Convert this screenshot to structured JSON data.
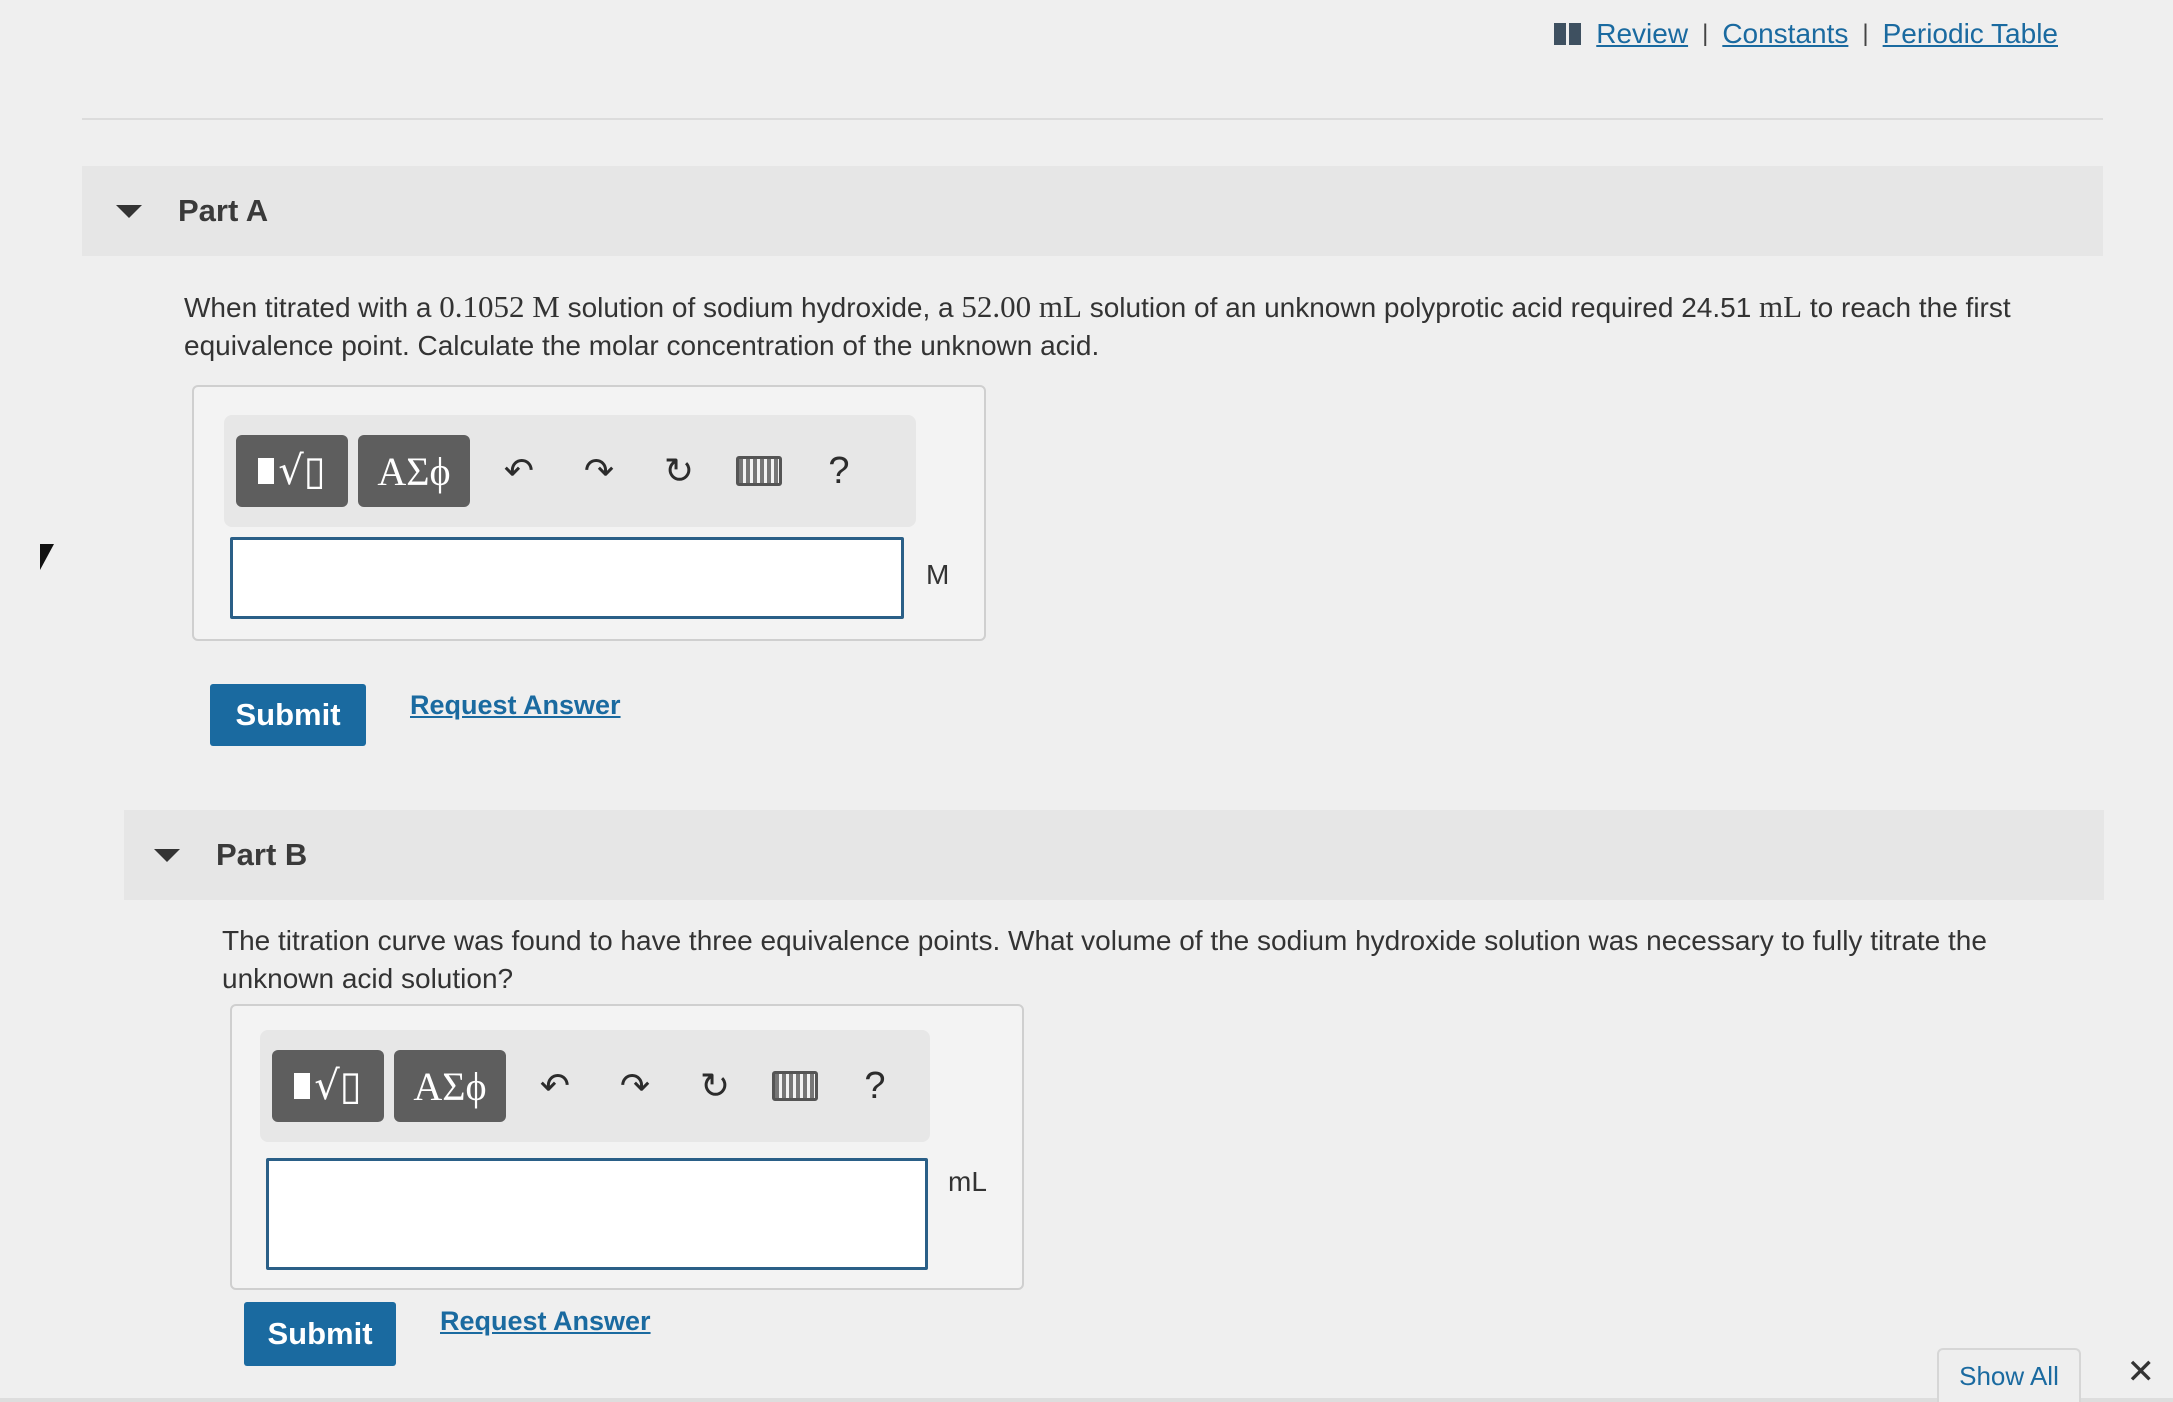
{
  "links": {
    "review": "Review",
    "constants": "Constants",
    "periodic_table": "Periodic Table",
    "separator": "|"
  },
  "part_a": {
    "title": "Part A",
    "q_1": "When titrated with a",
    "q_conc": "0.1052 M",
    "q_2": "solution of sodium hydroxide, a",
    "q_vol_acid": "52.00 mL",
    "q_3": "solution of an unknown polyprotic acid required 24.51",
    "q_unit_ml": "mL",
    "q_4": "to reach the first equivalence point. Calculate the molar concentration of the unknown acid.",
    "symbols_label": "ΑΣϕ",
    "help_label": "?",
    "unit": "M",
    "submit_label": "Submit",
    "request_answer_label": "Request Answer"
  },
  "part_b": {
    "title": "Part B",
    "question": "The titration curve was found to have three equivalence points. What volume of the sodium hydroxide solution was necessary to fully titrate the unknown acid solution?",
    "symbols_label": "ΑΣϕ",
    "help_label": "?",
    "unit": "mL",
    "submit_label": "Submit",
    "request_answer_label": "Request Answer"
  },
  "footer": {
    "show_all": "Show All",
    "close_glyph": "✕"
  }
}
